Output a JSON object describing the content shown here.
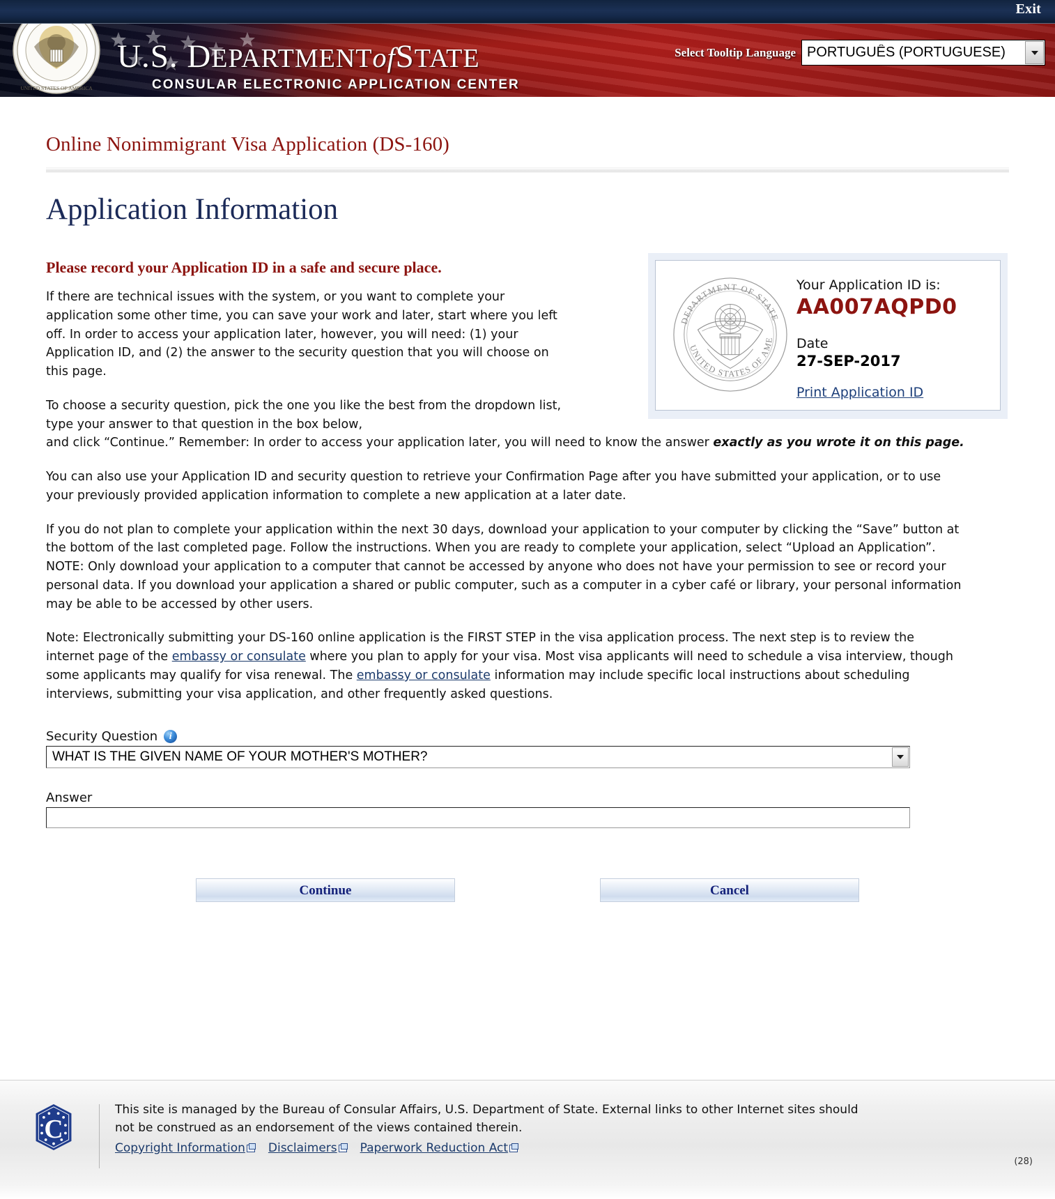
{
  "topbar": {
    "exit_label": "Exit"
  },
  "banner": {
    "org_line1_a": "U.S. D",
    "org_line1_b": "epartment",
    "org_line1_of": " of ",
    "org_line1_c": "S",
    "org_line1_d": "tate",
    "org_line2": "CONSULAR ELECTRONIC APPLICATION CENTER",
    "language_label": "Select Tooltip Language",
    "language_value": "PORTUGUÊS (PORTUGUESE)"
  },
  "page": {
    "app_title": "Online Nonimmigrant Visa Application (DS-160)",
    "heading": "Application Information"
  },
  "id_card": {
    "app_id_label": "Your Application ID is:",
    "app_id_value": "AA007AQPD0",
    "date_label": "Date",
    "date_value": "27-SEP-2017",
    "print_link": "Print Application ID"
  },
  "intro": {
    "red_heading": "Please record your Application ID in a safe and secure place.",
    "para1": "If there are technical issues with the system, or you want to complete your application some other time, you can save your work and later, start where you left off. In order to access your application later, however, you will need: (1) your Application ID, and (2) the answer to the security question that you will choose on this page.",
    "para2_line1": "To choose a security question, pick the one you like the best from the dropdown list, type your answer to that question in the box below,",
    "para2_line2_a": "and click “Continue.” Remember: In order to access your application later, you will need to know the answer ",
    "para2_emphasis": "exactly as you wrote it on this page.",
    "para3": "You can also use your Application ID and security question to retrieve your Confirmation Page after you have submitted your application, or to use your previously provided application information to complete a new application at a later date.",
    "para4": "If you do not plan to complete your application within the next 30 days, download your application to your computer by clicking the “Save” button at the bottom of the last completed page. Follow the instructions. When you are ready to complete your application, select “Upload an Application”. NOTE: Only download your application to a computer that cannot be accessed by anyone who does not have your permission to see or record your personal data. If you download your application a shared or public computer, such as a computer in a cyber café or library, your personal information may be able to be accessed by other users.",
    "para5_a": "Note: Electronically submitting your DS-160 online application is the FIRST STEP in the visa application process. The next step is to review the internet page of the ",
    "para5_link1": "embassy or consulate",
    "para5_b": " where you plan to apply for your visa. Most visa applicants will need to schedule a visa interview, though some applicants may qualify for visa renewal. The ",
    "para5_link2": "embassy or consulate",
    "para5_c": " information may include specific local instructions about scheduling interviews, submitting your visa application, and other frequently asked questions."
  },
  "form": {
    "security_question_label": "Security Question",
    "security_question_value": "WHAT IS THE GIVEN NAME OF YOUR MOTHER'S MOTHER?",
    "answer_label": "Answer",
    "answer_value": "",
    "answer_placeholder": ""
  },
  "buttons": {
    "continue_label": "Continue",
    "cancel_label": "Cancel"
  },
  "footer": {
    "text_line1": "This site is managed by the Bureau of Consular Affairs, U.S. Department of State. External links to other Internet sites should",
    "text_line2": "not be construed as an endorsement of the views contained therein.",
    "link_copyright": "Copyright Information",
    "link_disclaimers": "Disclaimers",
    "link_paperwork": "Paperwork Reduction Act",
    "page_number": "(28)"
  },
  "colors": {
    "banner_red": "#a81c14",
    "topbar_navy": "#15294a",
    "title_maroon": "#8c1410",
    "heading_navy": "#1b2a58",
    "link_blue": "#1b3a6b"
  }
}
